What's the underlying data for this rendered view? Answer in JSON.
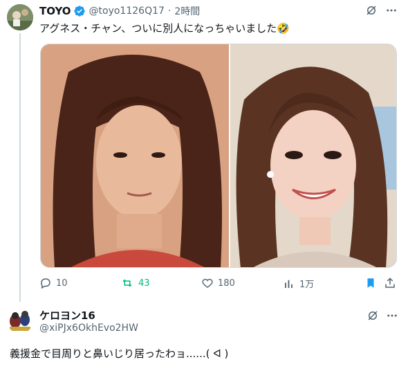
{
  "tweet": {
    "author_name": "TOYO",
    "handle": "@toyo1126Q17",
    "separator": "·",
    "time": "2時間",
    "text": "アグネス・チャン、ついに別人になっちゃいました🤣",
    "stats": {
      "replies": "10",
      "retweets": "43",
      "likes": "180",
      "views": "1万"
    }
  },
  "reply": {
    "author_name": "ケロヨン16",
    "handle": "@xiPJx6OkhEvo2HW",
    "text": "義援金で目周りと鼻いじり居ったわョ......( ᐊ )"
  },
  "colors": {
    "verified": "#1d9bf0",
    "retweet_active": "#00ba7c",
    "bookmark_active": "#1d9bf0",
    "secondary_text": "#536471"
  },
  "icons": [
    "grok-icon",
    "more-icon",
    "reply-icon",
    "retweet-icon",
    "like-icon",
    "views-icon",
    "bookmark-icon",
    "share-icon",
    "verified-icon"
  ]
}
